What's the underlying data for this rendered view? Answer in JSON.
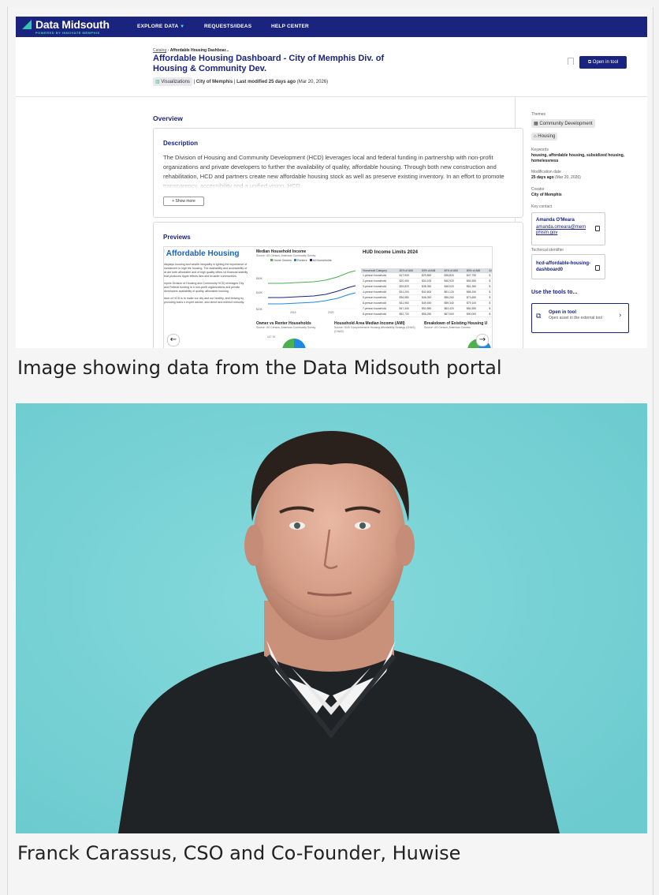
{
  "nav": {
    "logo": "Data Midsouth",
    "logo_sub": "POWERED BY INNOVATE MEMPHIS",
    "links": [
      "EXPLORE DATA",
      "REQUESTS/IDEAS",
      "HELP CENTER"
    ]
  },
  "breadcrumb": {
    "root": "Catalog",
    "current": "Affordable Housing Dashboar..."
  },
  "dataset": {
    "title": "Affordable Housing Dashboard - City of Memphis Div. of Housing & Community Dev.",
    "type_chip": "Visualizations",
    "publisher": "City of Memphis",
    "modified": "Last modified 25 days ago",
    "modified_date": "(Mar 20, 2026)",
    "open_button": "Open in tool"
  },
  "overview": {
    "heading": "Overview",
    "desc_heading": "Description",
    "description": "The Division of Housing and Community Development (HCD) leverages local and federal funding in partnership with non-profit organizations and private developers to further the availability of quality, affordable housing. Through both new construction and rehabilitation, HCD and partners create new affordable housing stock as well as preserve existing inventory. In an effort to promote transparency, accessibility and a unified vision, HCD",
    "show_more": "Show more"
  },
  "previews": {
    "heading": "Previews",
    "left_title": "f Affordable Housing",
    "left_text_1": "displays housing and wealth inequality in ighting the importance of investment in high ble housing. The availability and accessibility of at are both affordable and of high quality offers nd financial stability that produces ripple effects ilies and broader communities.",
    "left_text_2": "mphis Division of Housing and Community HCD) leverages City and Federal funding in h non-profit organizations and private developers availability of quality, affordable housing.",
    "left_text_3": "ision of HCD is to make our city and our healthy, and thriving by providing loans o expert advice, and direct and indirect mmunity.",
    "charts": [
      {
        "title": "Median Household Income",
        "source": "Source: US Census, American Community Survey"
      },
      {
        "title": "Owner vs Renter Households",
        "source": "Source: US Census, American Community Survey"
      },
      {
        "title": "Household Area Median Income (AMI)",
        "source": "Source: HUD Comprehensive Housing Affordability Strategy (CHAS)"
      },
      {
        "title": "Breakdown of Existing Housing U",
        "source": "Source: US Census, American Commu"
      }
    ],
    "legend": [
      "Home Owners",
      "Renters",
      "All Households"
    ],
    "y_ticks": [
      "$60K",
      "$40K",
      "$20K"
    ],
    "x_ticks": [
      "2015",
      "2020"
    ],
    "pie_label": "117.7K",
    "hud_title": "HUD Income Limits 2024",
    "hud_headers": [
      "Household Category",
      "30% of AMI",
      "50% of AMI",
      "60% of AMI",
      "80% of AMI",
      "AI"
    ],
    "hud_rows": [
      [
        "1-person household",
        "$17,900",
        "$29,850",
        "$35,820",
        "$47,750",
        "$"
      ],
      [
        "2-person household",
        "$20,450",
        "$34,100",
        "$40,920",
        "$54,550",
        "$"
      ],
      [
        "3-person household",
        "$25,820",
        "$38,350",
        "$46,020",
        "$61,350",
        "$"
      ],
      [
        "4-person household",
        "$31,200",
        "$42,600",
        "$51,120",
        "$68,150",
        "$"
      ],
      [
        "5-person household",
        "$36,580",
        "$46,050",
        "$55,260",
        "$73,650",
        "$"
      ],
      [
        "6-person household",
        "$41,960",
        "$49,450",
        "$59,340",
        "$79,100",
        "$"
      ],
      [
        "7-person household",
        "$47,340",
        "$52,850",
        "$63,420",
        "$84,550",
        "$"
      ],
      [
        "8-person household",
        "$52,720",
        "$56,250",
        "$67,500",
        "$90,000",
        "$"
      ]
    ]
  },
  "sidebar": {
    "themes_label": "Themes",
    "themes": [
      "Community Development",
      "Housing"
    ],
    "keywords_label": "Keywords",
    "keywords": "housing, affordable housing, subsidized housing, homelessness",
    "modification_label": "Modification date",
    "modification": "25 days ago",
    "modification_date": "(Mar 20, 2026)",
    "creator_label": "Creator",
    "creator": "City of Memphis",
    "contact_label": "Key contact",
    "contact_name": "Amanda O'Meara",
    "contact_email": "amanda.omeara@memphistn.gov",
    "tech_label": "Technical identifier",
    "tech_id": "hcd-affordable-housing-dashboard0",
    "use_tools": "Use the tools to...",
    "tool_title": "Open in tool",
    "tool_sub": "Open asset in the external tool"
  },
  "captions": {
    "first": "Image showing data from the Data Midsouth portal",
    "second": "Franck Carassus, CSO and Co-Founder, Huwise"
  },
  "colors": {
    "brand_navy": "#1a237e",
    "accent_teal": "#2ec4b6",
    "photo_bg": "#77d1d4"
  }
}
